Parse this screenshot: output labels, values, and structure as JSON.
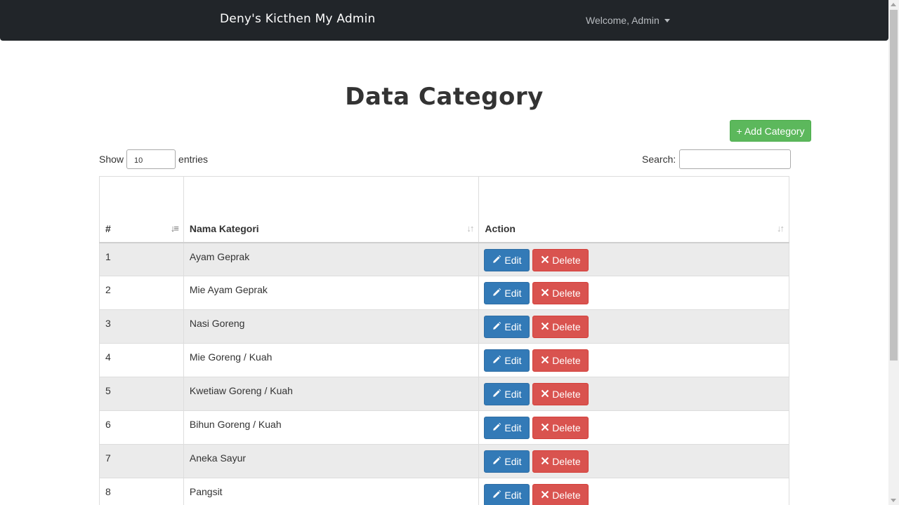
{
  "navbar": {
    "brand": "Deny's Kicthen My Admin",
    "user_menu": "Welcome, Admin"
  },
  "page": {
    "title": "Data Category",
    "add_button": "+ Add Category"
  },
  "table_controls": {
    "show_label": "Show",
    "entries_value": "10",
    "entries_label": "entries",
    "search_label": "Search:",
    "search_value": ""
  },
  "table": {
    "columns": [
      "#",
      "Nama Kategori",
      "Action"
    ],
    "rows": [
      {
        "no": "1",
        "name": "Ayam Geprak"
      },
      {
        "no": "2",
        "name": "Mie Ayam Geprak"
      },
      {
        "no": "3",
        "name": "Nasi Goreng"
      },
      {
        "no": "4",
        "name": "Mie Goreng / Kuah"
      },
      {
        "no": "5",
        "name": "Kwetiaw Goreng / Kuah"
      },
      {
        "no": "6",
        "name": "Bihun Goreng / Kuah"
      },
      {
        "no": "7",
        "name": "Aneka Sayur"
      },
      {
        "no": "8",
        "name": "Pangsit"
      }
    ],
    "edit_label": "Edit",
    "delete_label": "Delete"
  },
  "icons": {
    "edit": "pencil-icon",
    "delete": "times-icon",
    "sort_active": "sort-numeric-asc-icon",
    "sort": "sort-icon",
    "dropdown": "caret-down-icon"
  },
  "colors": {
    "navbar_bg": "#212529",
    "add_button": "#5cb85c",
    "edit_button": "#337ab7",
    "delete_button": "#d9534f",
    "row_stripe": "#ebebeb"
  }
}
